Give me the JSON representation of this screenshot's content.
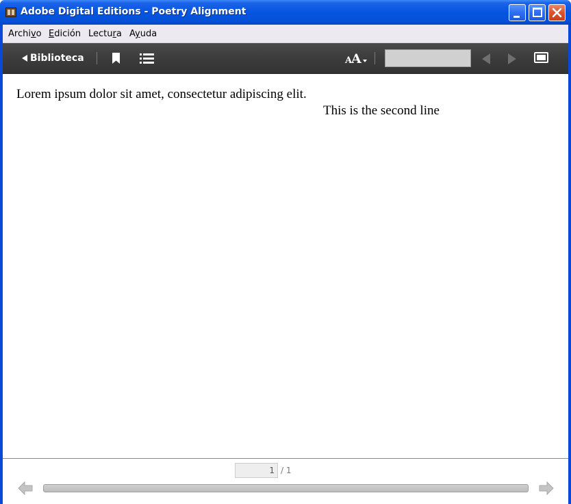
{
  "window": {
    "title": "Adobe Digital Editions - Poetry Alignment"
  },
  "menubar": {
    "items": [
      {
        "pre": "Archi",
        "u": "v",
        "post": "o"
      },
      {
        "pre": "",
        "u": "E",
        "post": "dición"
      },
      {
        "pre": "Lectu",
        "u": "r",
        "post": "a"
      },
      {
        "pre": "A",
        "u": "y",
        "post": "uda"
      }
    ]
  },
  "toolbar": {
    "back_label": "Biblioteca",
    "font_size_small": "A",
    "font_size_big": "A",
    "page_input_value": ""
  },
  "content": {
    "lines": [
      "Lorem ipsum dolor sit amet, consectetur adipiscing elit.",
      "This is the second line"
    ]
  },
  "footer": {
    "current_page": "1",
    "total_pages": "/ 1",
    "progress": 0
  },
  "colors": {
    "titlebar": "#0655e0",
    "toolbar": "#3c3c3c",
    "menubar": "#ece9f0"
  },
  "icons": [
    "app-icon",
    "minimize-icon",
    "maximize-icon",
    "close-icon",
    "back-arrow-icon",
    "bookmark-icon",
    "table-of-contents-icon",
    "font-size-icon",
    "previous-page-icon",
    "next-page-icon",
    "fullscreen-icon",
    "arrow-left-icon",
    "arrow-right-icon"
  ]
}
